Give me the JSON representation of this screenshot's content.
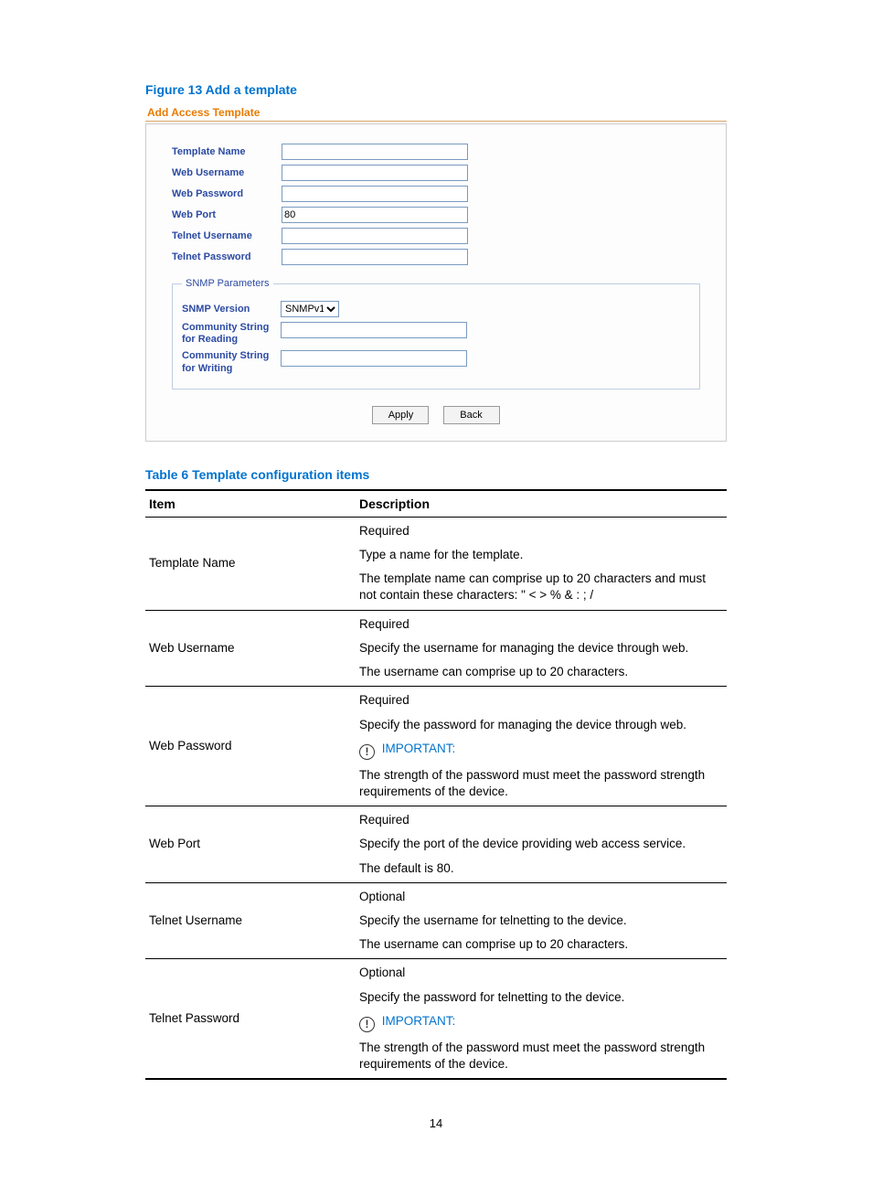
{
  "figure_caption": "Figure 13 Add a template",
  "form": {
    "title": "Add Access Template",
    "labels": {
      "template_name": "Template Name",
      "web_username": "Web Username",
      "web_password": "Web Password",
      "web_port": "Web Port",
      "telnet_username": "Telnet Username",
      "telnet_password": "Telnet Password"
    },
    "values": {
      "template_name": "",
      "web_username": "",
      "web_password": "",
      "web_port": "80",
      "telnet_username": "",
      "telnet_password": ""
    },
    "snmp": {
      "legend": "SNMP Parameters",
      "version_label": "SNMP Version",
      "version_value": "SNMPv1",
      "read_label": "Community String for Reading",
      "write_label": "Community String for Writing",
      "read_value": "",
      "write_value": ""
    },
    "buttons": {
      "apply": "Apply",
      "back": "Back"
    }
  },
  "table_caption": "Table 6 Template configuration items",
  "headers": {
    "item": "Item",
    "desc": "Description"
  },
  "important_label": "IMPORTANT:",
  "rows": [
    {
      "item": "Template Name",
      "desc": [
        "Required",
        "Type a name for the template.",
        "The template name can comprise up to 20 characters and must not contain these characters: \" < > % & : ; /"
      ]
    },
    {
      "item": "Web Username",
      "desc": [
        "Required",
        "Specify the username for managing the device through web.",
        "The username can comprise up to 20 characters."
      ]
    },
    {
      "item": "Web Password",
      "desc": [
        "Required",
        "Specify the password for managing the device through web.",
        {
          "important": true
        },
        "The strength of the password must meet the password strength requirements of the device."
      ]
    },
    {
      "item": "Web Port",
      "desc": [
        "Required",
        "Specify the port of the device providing web access service.",
        "The default is 80."
      ]
    },
    {
      "item": "Telnet Username",
      "desc": [
        "Optional",
        "Specify the username for telnetting to the device.",
        "The username can comprise up to 20 characters."
      ]
    },
    {
      "item": "Telnet Password",
      "desc": [
        "Optional",
        "Specify the password for telnetting to the device.",
        {
          "important": true
        },
        "The strength of the password must meet the password strength requirements of the device."
      ]
    }
  ],
  "page_number": "14"
}
